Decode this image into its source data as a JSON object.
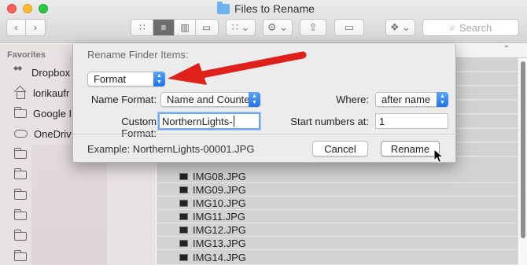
{
  "window": {
    "title": "Files to Rename"
  },
  "toolbar": {
    "search_placeholder": "Search",
    "back_icon": "chevron-left-icon",
    "forward_icon": "chevron-right-icon"
  },
  "sidebar": {
    "heading": "Favorites",
    "items": [
      {
        "label": "Dropbox",
        "icon": "dropbox-icon"
      },
      {
        "label": "lorikaufr",
        "icon": "home-icon"
      },
      {
        "label": "Google I",
        "icon": "folder-icon"
      },
      {
        "label": "OneDriv",
        "icon": "cloud-icon"
      }
    ]
  },
  "files": [
    {
      "name": "IMG08.JPG"
    },
    {
      "name": "IMG09.JPG"
    },
    {
      "name": "IMG10.JPG"
    },
    {
      "name": "IMG11.JPG"
    },
    {
      "name": "IMG12.JPG"
    },
    {
      "name": "IMG13.JPG"
    },
    {
      "name": "IMG14.JPG"
    }
  ],
  "dialog": {
    "title": "Rename Finder Items:",
    "mode_value": "Format",
    "name_format_label": "Name Format:",
    "name_format_value": "Name and Counter",
    "where_label": "Where:",
    "where_value": "after name",
    "custom_format_label": "Custom Format:",
    "custom_format_value": "NorthernLights-",
    "start_numbers_label": "Start numbers at:",
    "start_numbers_value": "1",
    "example": "Example: NorthernLights-00001.JPG",
    "cancel_label": "Cancel",
    "rename_label": "Rename"
  },
  "colors": {
    "annotation_arrow": "#e0201b",
    "accent_blue": "#2a7be8"
  }
}
